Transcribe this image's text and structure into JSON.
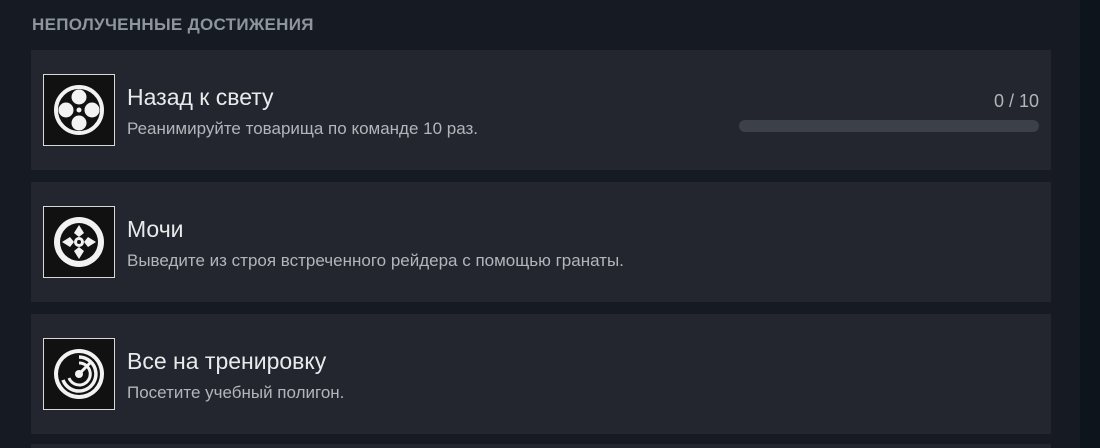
{
  "section": {
    "title": "НЕПОЛУЧЕННЫЕ ДОСТИЖЕНИЯ"
  },
  "achievements": [
    {
      "title": "Назад к свету",
      "description": "Реанимируйте товарища по команде 10 раз.",
      "icon": "revive-icon",
      "progress_text": "0 / 10",
      "progress_fraction": 0
    },
    {
      "title": "Мочи",
      "description": "Выведите из строя встреченного рейдера с помощью гранаты.",
      "icon": "grenade-burst-icon"
    },
    {
      "title": "Все на тренировку",
      "description": "Посетите учебный полигон.",
      "icon": "training-target-icon"
    }
  ],
  "colors": {
    "page_background": "#161b23",
    "card_background": "#23262e",
    "title_text": "#e8eaec",
    "description_text": "#b2b6bb",
    "section_title_text": "#8e959c",
    "progress_track": "#3c4048"
  }
}
